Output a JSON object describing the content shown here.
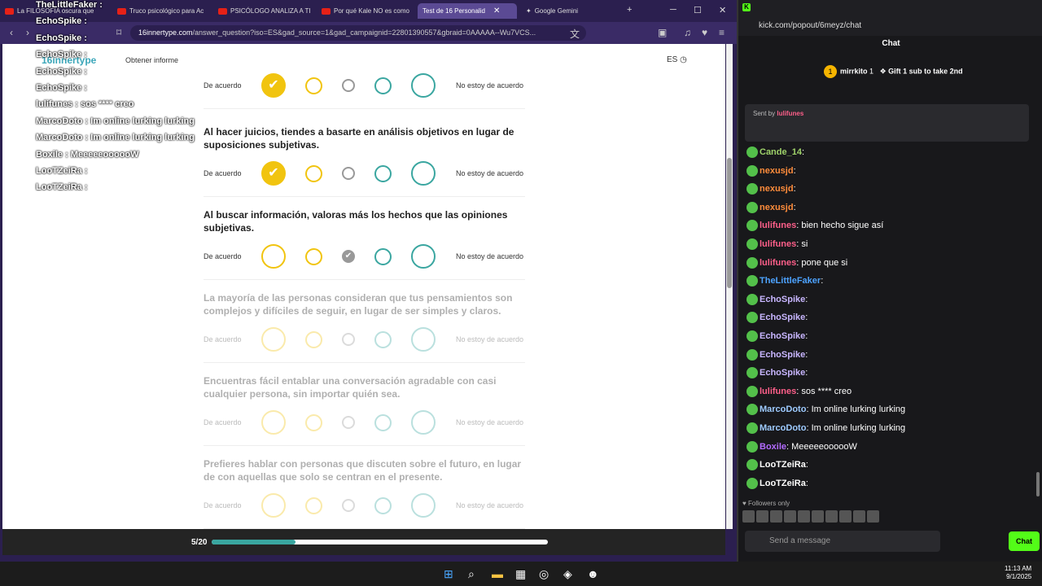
{
  "browser": {
    "tabs": [
      {
        "label": "La FILOSOFÍA oscura que",
        "active": false
      },
      {
        "label": "Truco psicológico para Ac",
        "active": false
      },
      {
        "label": "PSICÓLOGO ANALIZA A TI",
        "active": false
      },
      {
        "label": "Por qué Kale NO es como",
        "active": false
      },
      {
        "label": "Test de 16 Personalid",
        "active": true
      },
      {
        "label": "Google Gemini",
        "active": false
      }
    ],
    "url_domain": "16innertype.com",
    "url_path": "/answer_question?iso=ES&gad_source=1&gad_campaignid=22801390557&gbraid=0AAAAA--Wu7VCS..."
  },
  "page": {
    "logo": "16innertype",
    "report_link": "Obtener informe",
    "language": "ES",
    "agree_label": "De acuerdo",
    "disagree_label": "No estoy de acuerdo",
    "questions": [
      {
        "text": "",
        "selected": 1,
        "faded": false
      },
      {
        "text": "Al hacer juicios, tiendes a basarte en análisis objetivos en lugar de suposiciones subjetivas.",
        "selected": 1,
        "faded": false
      },
      {
        "text": "Al buscar información, valoras más los hechos que las opiniones subjetivas.",
        "selected": 3,
        "faded": false
      },
      {
        "text": "La mayoría de las personas consideran que tus pensamientos son complejos y difíciles de seguir, en lugar de ser simples y claros.",
        "selected": 0,
        "faded": true
      },
      {
        "text": "Encuentras fácil entablar una conversación agradable con casi cualquier persona, sin importar quién sea.",
        "selected": 0,
        "faded": true
      },
      {
        "text": "Prefieres hablar con personas que discuten sobre el futuro, en lugar de con aquellas que solo se centran en el presente.",
        "selected": 0,
        "faded": true
      }
    ],
    "progress_label": "5/20",
    "progress_fraction": 0.25
  },
  "overlay_chat": [
    {
      "user": "TheLittleFaker",
      "text": ""
    },
    {
      "user": "EchoSpike",
      "text": ""
    },
    {
      "user": "EchoSpike",
      "text": ""
    },
    {
      "user": "EchoSpike",
      "text": ""
    },
    {
      "user": "EchoSpike",
      "text": ""
    },
    {
      "user": "EchoSpike",
      "text": ""
    },
    {
      "user": "lulifunes",
      "text": "sos **** creo"
    },
    {
      "user": "MarcoDoto",
      "text": "Im online lurking lurking"
    },
    {
      "user": "MarcoDoto",
      "text": "Im online lurking lurking"
    },
    {
      "user": "Boxile",
      "text": "MeeeeeoooooW"
    },
    {
      "user": "LooTZeiRa",
      "text": ""
    },
    {
      "user": "LooTZeiRa",
      "text": ""
    }
  ],
  "chat": {
    "url": "kick.com/popout/6meyz/chat",
    "title": "Chat",
    "gift_user": "mirrkito",
    "gift_count": "1",
    "gift_text": "Gift 1 sub to take 2nd",
    "pinned_label": "Sent by",
    "pinned_user": "lulifunes",
    "messages": [
      {
        "user": "Cande_14",
        "text": "",
        "color": "#9fd26a"
      },
      {
        "user": "nexusjd",
        "text": "",
        "color": "#ff8c3b"
      },
      {
        "user": "nexusjd",
        "text": "",
        "color": "#ff8c3b"
      },
      {
        "user": "nexusjd",
        "text": "",
        "color": "#ff8c3b"
      },
      {
        "user": "lulifunes",
        "text": "bien hecho sigue así",
        "color": "#ff5f8a"
      },
      {
        "user": "lulifunes",
        "text": "si",
        "color": "#ff5f8a"
      },
      {
        "user": "lulifunes",
        "text": "pone que si",
        "color": "#ff5f8a"
      },
      {
        "user": "TheLittleFaker",
        "text": "",
        "color": "#4da3ff"
      },
      {
        "user": "EchoSpike",
        "text": "",
        "color": "#c8b6ff"
      },
      {
        "user": "EchoSpike",
        "text": "",
        "color": "#c8b6ff"
      },
      {
        "user": "EchoSpike",
        "text": "",
        "color": "#c8b6ff"
      },
      {
        "user": "EchoSpike",
        "text": "",
        "color": "#c8b6ff"
      },
      {
        "user": "EchoSpike",
        "text": "",
        "color": "#c8b6ff"
      },
      {
        "user": "lulifunes",
        "text": "sos **** creo",
        "color": "#ff5f8a"
      },
      {
        "user": "MarcoDoto",
        "text": "Im online lurking lurking",
        "color": "#9ecbff"
      },
      {
        "user": "MarcoDoto",
        "text": "Im online lurking lurking",
        "color": "#9ecbff"
      },
      {
        "user": "Boxile",
        "text": "MeeeeeoooooW",
        "color": "#b36bff"
      },
      {
        "user": "LooTZeiRa",
        "text": "",
        "color": "#ffffff"
      },
      {
        "user": "LooTZeiRa",
        "text": "",
        "color": "#ffffff"
      }
    ],
    "followers_only": "Followers only",
    "send_placeholder": "Send a message",
    "chat_button": "Chat"
  },
  "taskbar": {
    "time": "11:13 AM",
    "date": "9/1/2025"
  }
}
